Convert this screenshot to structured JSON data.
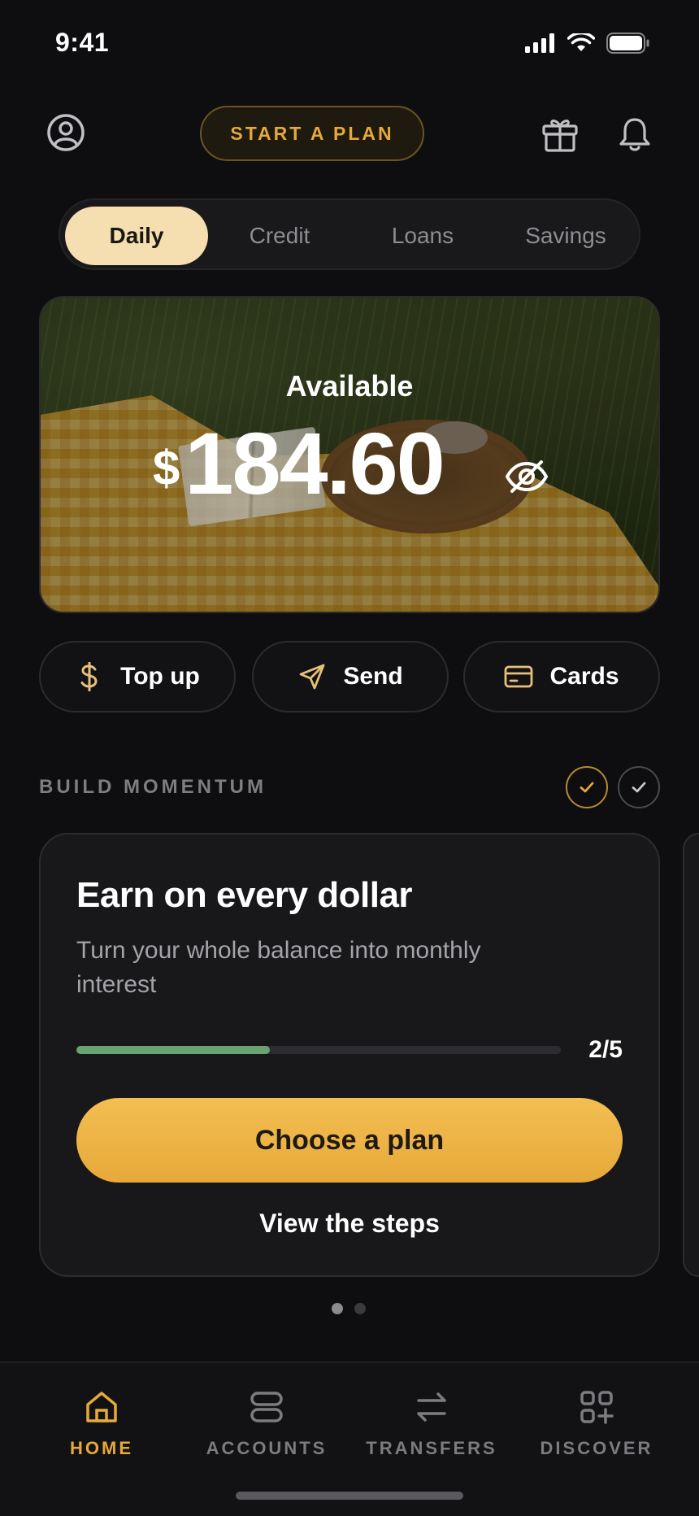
{
  "status_bar": {
    "time": "9:41"
  },
  "header": {
    "plan_button_label": "START A PLAN"
  },
  "segments": [
    {
      "label": "Daily",
      "active": true
    },
    {
      "label": "Credit",
      "active": false
    },
    {
      "label": "Loans",
      "active": false
    },
    {
      "label": "Savings",
      "active": false
    }
  ],
  "balance": {
    "label": "Available",
    "currency": "$",
    "amount": "184.60"
  },
  "quick_actions": [
    {
      "label": "Top up",
      "icon": "dollar-icon"
    },
    {
      "label": "Send",
      "icon": "send-icon"
    },
    {
      "label": "Cards",
      "icon": "card-icon"
    }
  ],
  "momentum": {
    "section_title": "BUILD MOMENTUM",
    "card": {
      "title": "Earn on every dollar",
      "subtitle": "Turn your whole balance into monthly interest",
      "progress_text": "2/5",
      "progress_fraction": 0.4,
      "primary_button": "Choose a plan",
      "secondary_link": "View the steps"
    },
    "pager": {
      "count": 2,
      "active_index": 0
    }
  },
  "tabbar": [
    {
      "label": "HOME",
      "icon": "home-icon",
      "active": true
    },
    {
      "label": "ACCOUNTS",
      "icon": "accounts-icon",
      "active": false
    },
    {
      "label": "TRANSFERS",
      "icon": "transfers-icon",
      "active": false
    },
    {
      "label": "DISCOVER",
      "icon": "discover-icon",
      "active": false
    }
  ],
  "colors": {
    "background": "#0e0e10",
    "accent": "#e6a93a",
    "segment_active": "#f5deb0",
    "progress": "#6aa271"
  }
}
